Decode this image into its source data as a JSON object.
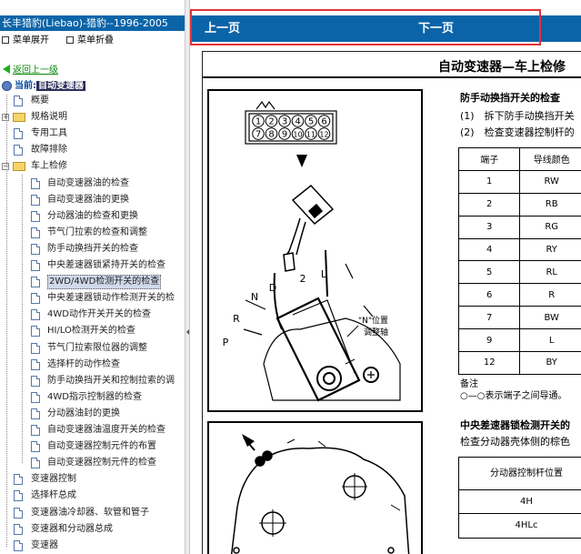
{
  "left_panel": {
    "title": "长丰猎豹(Liebao)-猎豹--1996-2005",
    "menu": {
      "expand": "菜单展开",
      "collapse": "菜单折叠"
    },
    "back": "返回上一级",
    "current_label": "当前:",
    "current_value": "自动变速器",
    "tree": [
      {
        "label": "概要",
        "kind": "doc",
        "level": 1
      },
      {
        "label": "规格说明",
        "kind": "folder",
        "level": 1
      },
      {
        "label": "专用工具",
        "kind": "doc",
        "level": 1
      },
      {
        "label": "故障排除",
        "kind": "doc",
        "level": 1
      },
      {
        "label": "车上检修",
        "kind": "folder-open",
        "level": 1
      },
      {
        "label": "自动变速器油的检查",
        "kind": "doc",
        "level": 2
      },
      {
        "label": "自动变速器油的更换",
        "kind": "doc",
        "level": 2
      },
      {
        "label": "分动器油的检查和更换",
        "kind": "doc",
        "level": 2
      },
      {
        "label": "节气门拉索的检查和调整",
        "kind": "doc",
        "level": 2
      },
      {
        "label": "防手动换挡开关的检查",
        "kind": "doc",
        "level": 2
      },
      {
        "label": "中央差速器锁紧持开关的检查",
        "kind": "doc",
        "level": 2
      },
      {
        "label": "2WD/4WD检测开关的检查",
        "kind": "doc",
        "level": 2,
        "selected": true
      },
      {
        "label": "中央差速器锁动作检测开关的检",
        "kind": "doc",
        "level": 2
      },
      {
        "label": "4WD动作开关开关的检查",
        "kind": "doc",
        "level": 2
      },
      {
        "label": "HI/LO检测开关的检查",
        "kind": "doc",
        "level": 2
      },
      {
        "label": "节气门拉索限位器的调整",
        "kind": "doc",
        "level": 2
      },
      {
        "label": "选择杆的动作检查",
        "kind": "doc",
        "level": 2
      },
      {
        "label": "防手动换挡开关和控制拉索的调",
        "kind": "doc",
        "level": 2
      },
      {
        "label": "4WD指示控制器的检查",
        "kind": "doc",
        "level": 2
      },
      {
        "label": "分动器油封的更换",
        "kind": "doc",
        "level": 2
      },
      {
        "label": "自动变速器油温度开关的检查",
        "kind": "doc",
        "level": 2
      },
      {
        "label": "自动变速器控制元件的布置",
        "kind": "doc",
        "level": 2
      },
      {
        "label": "自动变速器控制元件的检查",
        "kind": "doc",
        "level": 2
      },
      {
        "label": "变速器控制",
        "kind": "doc",
        "level": 1
      },
      {
        "label": "选择杆总成",
        "kind": "doc",
        "level": 1
      },
      {
        "label": "变速器油冷却器、软管和管子",
        "kind": "doc",
        "level": 1
      },
      {
        "label": "变速器和分动器总成",
        "kind": "doc",
        "level": 1
      },
      {
        "label": "变速器",
        "kind": "doc",
        "level": 1
      }
    ]
  },
  "nav": {
    "prev": "上一页",
    "next": "下一页"
  },
  "page": {
    "title": "自动变速器—车上检修",
    "heading1": "防手动换挡开关的检查",
    "step1": "(1)　拆下防手动换挡开关",
    "step2": "(2)　检查变速器控制杆的",
    "table_headers": [
      "端子",
      "导线颜色"
    ],
    "table_rows": [
      [
        "1",
        "RW"
      ],
      [
        "2",
        "RB"
      ],
      [
        "3",
        "RG"
      ],
      [
        "4",
        "RY"
      ],
      [
        "5",
        "RL"
      ],
      [
        "6",
        "R"
      ],
      [
        "7",
        "BW"
      ],
      [
        "9",
        "L"
      ],
      [
        "12",
        "BY"
      ]
    ],
    "note_title": "备注",
    "note_text": "○—○表示端子之间导通。",
    "heading2": "中央差速器锁检测开关的",
    "heading2_sub": "检查分动器壳体侧的棕色",
    "table2_header": "分动器控制杆位置",
    "table2_rows": [
      "4H",
      "4HLc"
    ],
    "fig_labels": {
      "connector_pins_top": [
        "1",
        "2",
        "3",
        "4",
        "5",
        "6"
      ],
      "connector_pins_bottom": [
        "7",
        "8",
        "9",
        "10",
        "11",
        "12"
      ],
      "gears": [
        "P",
        "R",
        "N",
        "D",
        "2",
        "L"
      ],
      "n_position": "\"N\"位置",
      "adjust_bolt": "调整轴"
    }
  }
}
